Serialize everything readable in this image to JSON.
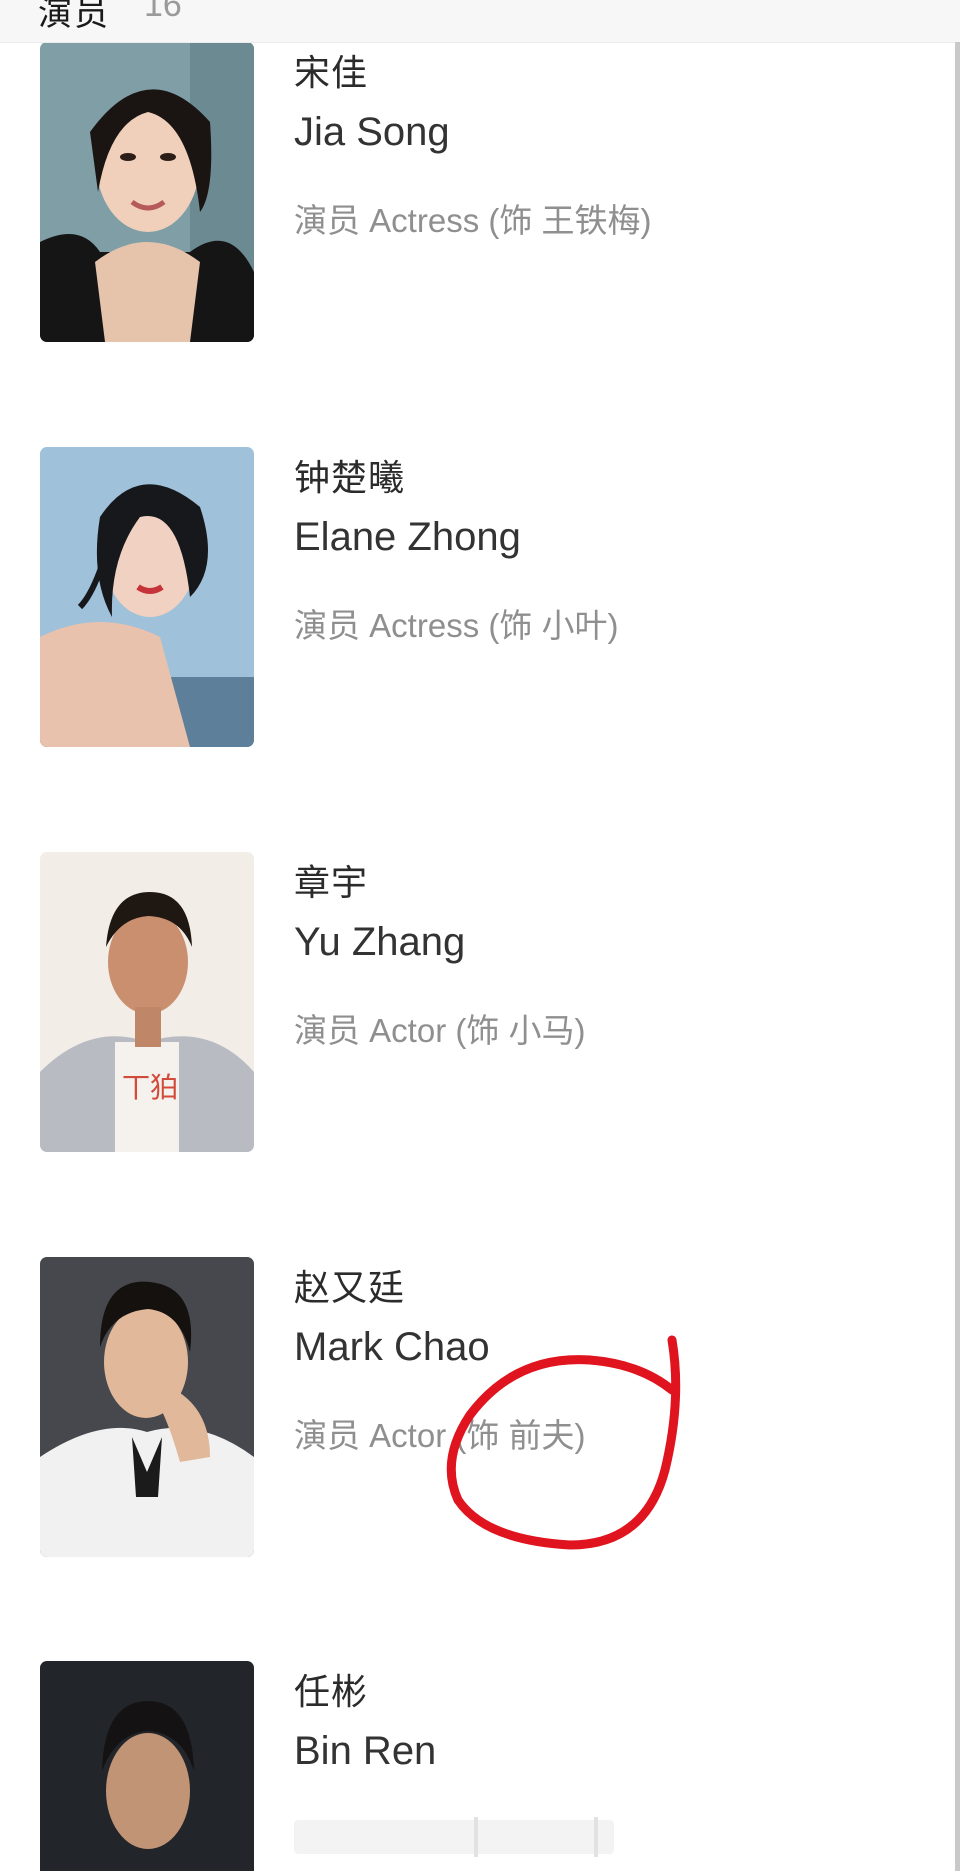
{
  "header": {
    "title": "演员",
    "count": "16"
  },
  "cast": [
    {
      "name_cn": "宋佳",
      "name_en": "Jia Song",
      "role": "演员 Actress (饰 王铁梅)"
    },
    {
      "name_cn": "钟楚曦",
      "name_en": "Elane Zhong",
      "role": "演员 Actress (饰 小叶)"
    },
    {
      "name_cn": "章宇",
      "name_en": "Yu Zhang",
      "role": "演员 Actor (饰 小马)"
    },
    {
      "name_cn": "赵又廷",
      "name_en": "Mark Chao",
      "role": "演员 Actor (饰 前夫)"
    },
    {
      "name_cn": "任彬",
      "name_en": "Bin Ren",
      "role": ""
    }
  ],
  "colors": {
    "annotation": "#e0141e",
    "accent_text": "#8f8f8f"
  }
}
